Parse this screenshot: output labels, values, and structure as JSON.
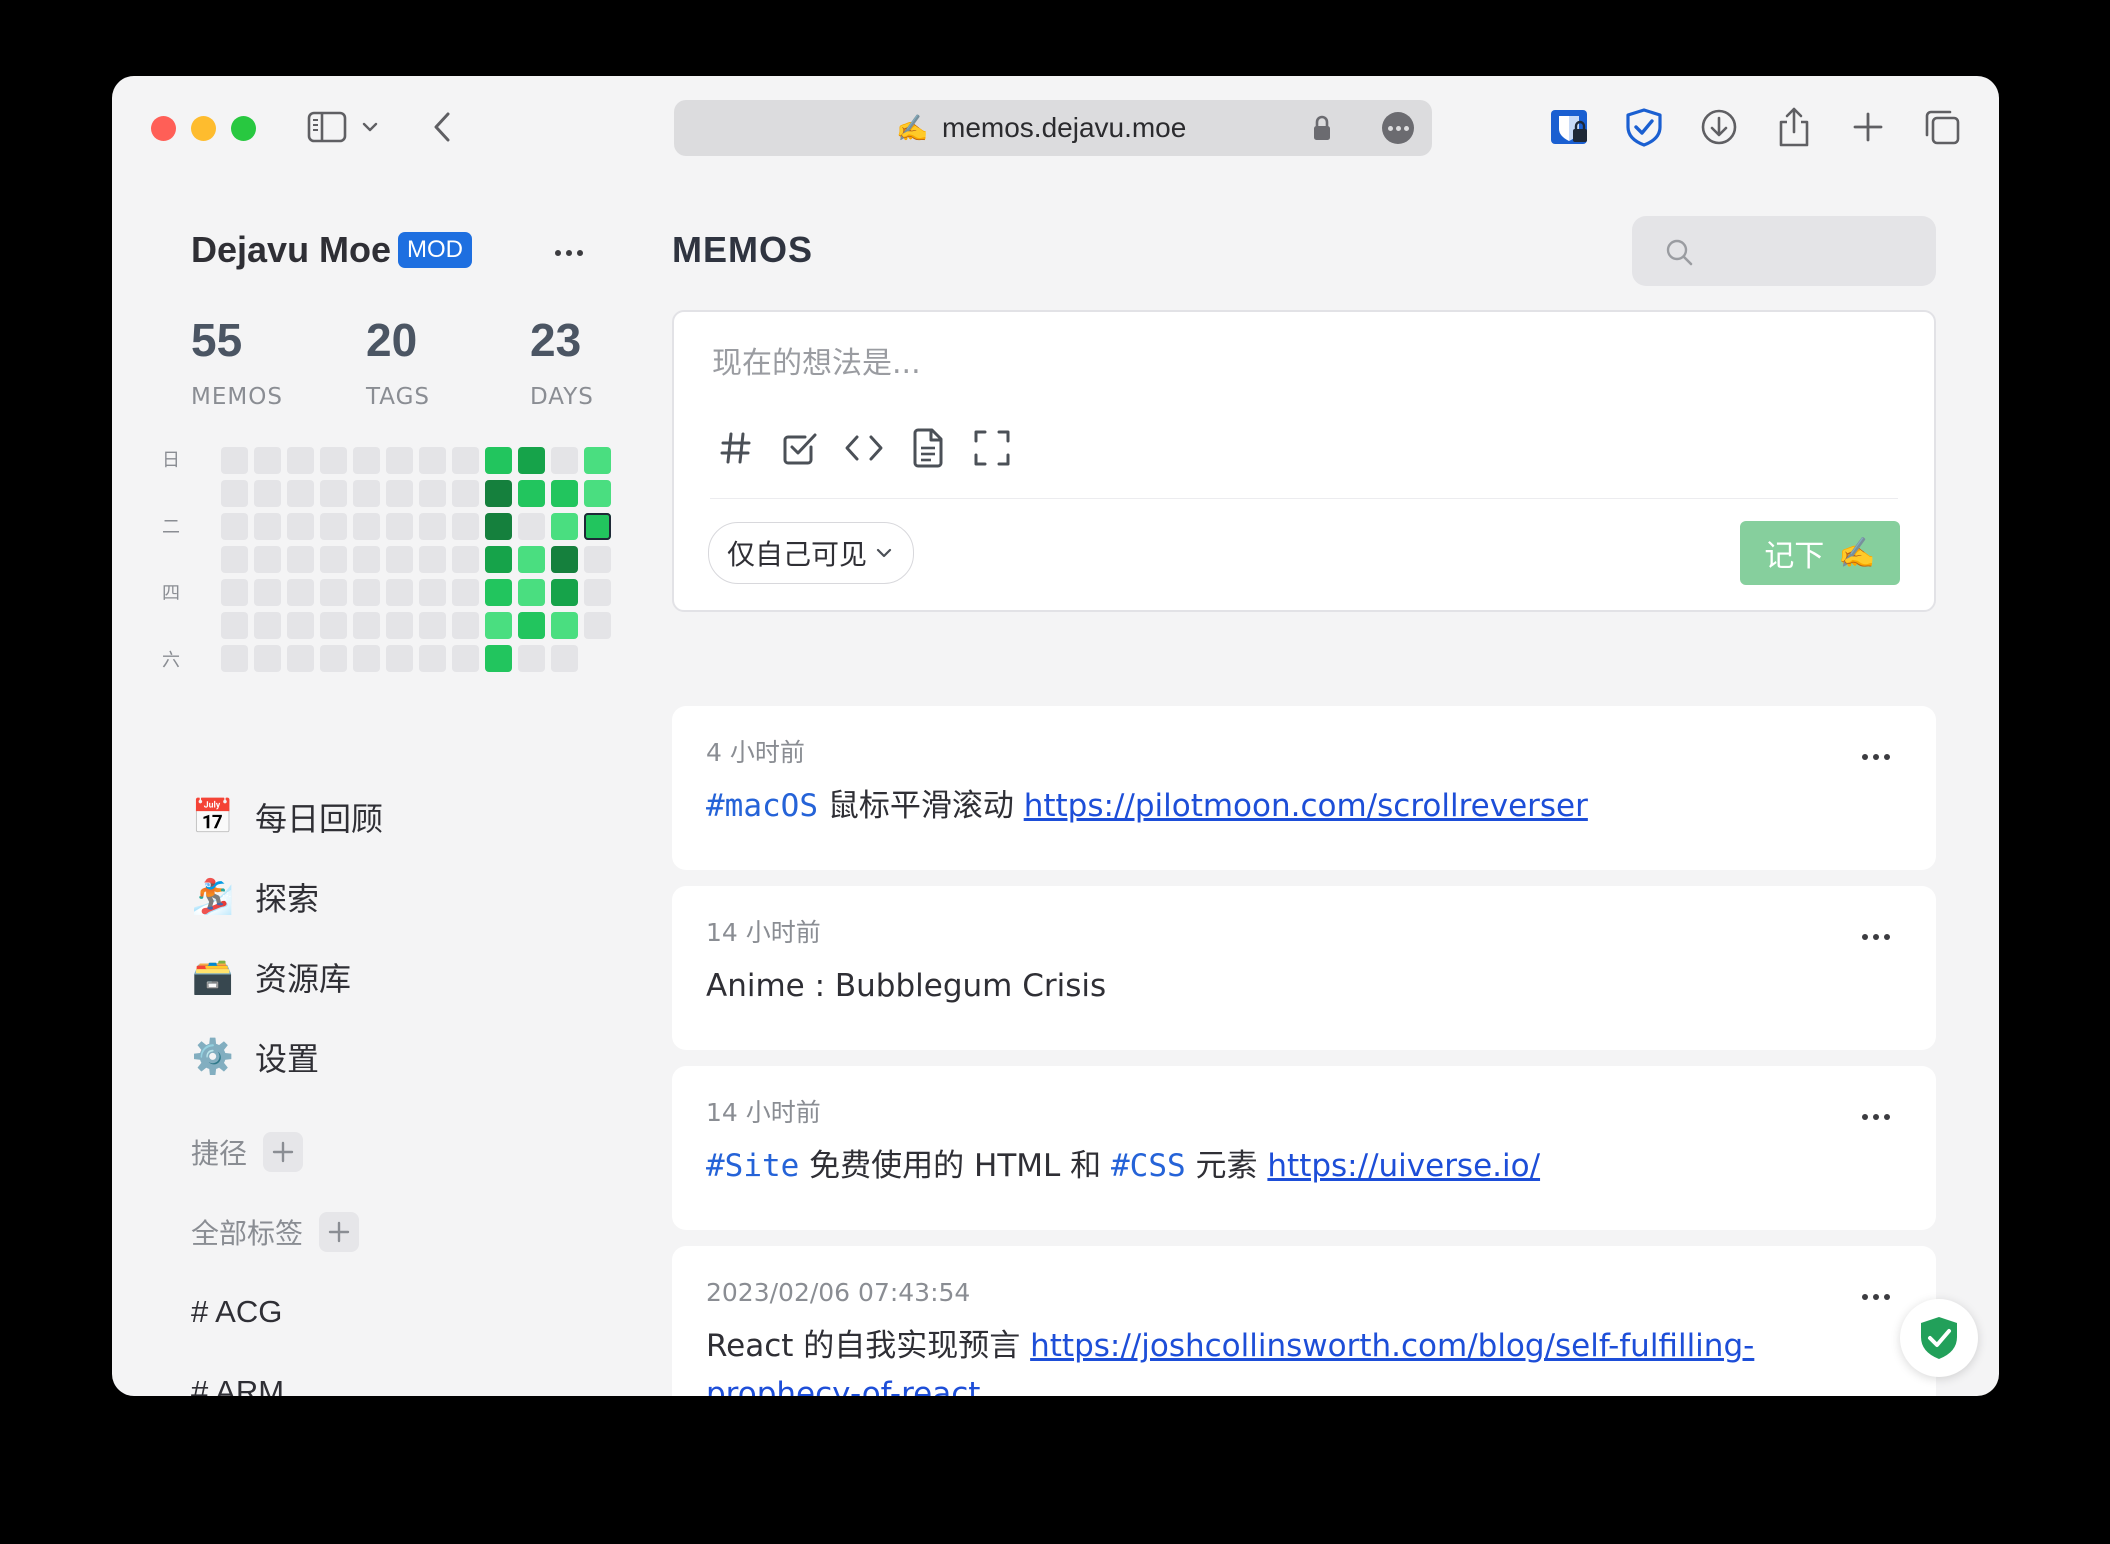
{
  "browser": {
    "url": "memos.dejavu.moe",
    "favicon": "✍️",
    "icons": [
      "sidebar-icon",
      "chevron-down-icon",
      "back-icon",
      "lock-icon",
      "more-icon",
      "bitwarden-icon",
      "shield-icon",
      "download-icon",
      "share-icon",
      "new-tab-icon",
      "tabs-icon"
    ]
  },
  "sidebar": {
    "user_name": "Dejavu Moe",
    "badge": "MOD",
    "stats": [
      {
        "value": "55",
        "label": "MEMOS"
      },
      {
        "value": "20",
        "label": "TAGS"
      },
      {
        "value": "23",
        "label": "DAYS"
      }
    ],
    "weekday_labels": [
      "日",
      "二",
      "四",
      "六"
    ],
    "heatmap_colors": {
      "empty": "#e4e4e7",
      "l1": "#4ade80",
      "l2": "#22c55e",
      "l3": "#16a34a",
      "l4": "#15803d"
    },
    "nav": [
      {
        "emoji": "📅",
        "label": "每日回顾"
      },
      {
        "emoji": "🏂",
        "label": "探索"
      },
      {
        "emoji": "🗃️",
        "label": "资源库"
      },
      {
        "emoji": "⚙️",
        "label": "设置"
      }
    ],
    "shortcuts_label": "捷径",
    "tags_label": "全部标签",
    "tags": [
      "# ACG",
      "# ARM"
    ]
  },
  "main": {
    "title": "MEMOS",
    "search": {
      "placeholder": ""
    },
    "editor": {
      "placeholder": "现在的想法是...",
      "tools": [
        "hash-icon",
        "checkbox-icon",
        "code-icon",
        "file-icon",
        "fullscreen-icon"
      ],
      "visibility": "仅自己可见",
      "submit_label": "记下",
      "submit_emoji": "✍️"
    },
    "memos": [
      {
        "time": "4 小时前",
        "parts": [
          {
            "type": "tag",
            "text": "#macOS"
          },
          {
            "type": "text",
            "text": " 鼠标平滑滚动 "
          },
          {
            "type": "link",
            "text": "https://pilotmoon.com/scrollreverser"
          }
        ]
      },
      {
        "time": "14 小时前",
        "parts": [
          {
            "type": "text",
            "text": "Anime : Bubblegum Crisis"
          }
        ]
      },
      {
        "time": "14 小时前",
        "parts": [
          {
            "type": "tag",
            "text": "#Site"
          },
          {
            "type": "text",
            "text": " 免费使用的 HTML 和 "
          },
          {
            "type": "tag",
            "text": "#CSS"
          },
          {
            "type": "text",
            "text": " 元素 "
          },
          {
            "type": "link",
            "text": "https://uiverse.io/"
          }
        ]
      },
      {
        "time": "2023/02/06 07:43:54",
        "parts": [
          {
            "type": "text",
            "text": "React 的自我实现预言 "
          },
          {
            "type": "link",
            "text": "https://joshcollinsworth.com/blog/self-fulfilling-prophecy-of-react"
          }
        ]
      }
    ]
  }
}
